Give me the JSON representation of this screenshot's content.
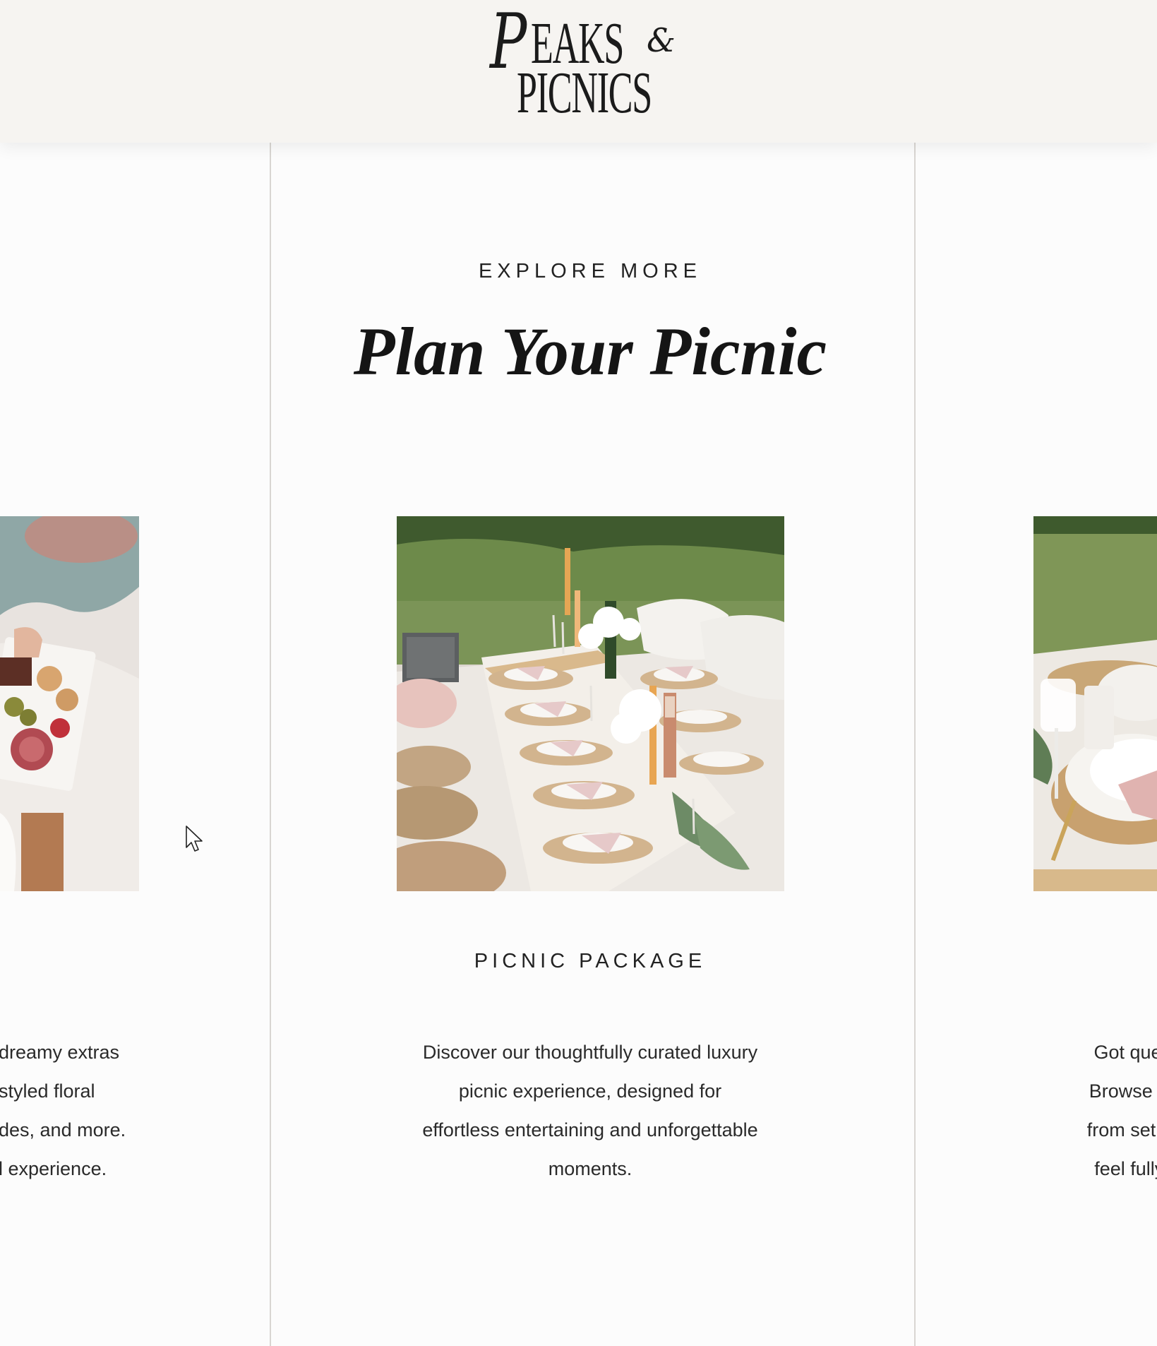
{
  "brand": {
    "logo_line1": "PEAKS",
    "logo_amp": "&",
    "logo_line2": "PICNICS"
  },
  "section": {
    "eyebrow": "EXPLORE MORE",
    "title": "Plan Your Picnic"
  },
  "cards": {
    "left": {
      "text": "dreamy extras\nstyled floral\ndes, and more.\nl experience."
    },
    "center": {
      "title": "PICNIC PACKAGE",
      "text": "Discover our thoughtfully curated luxury\npicnic experience, designed for\neffortless entertaining and unforgettable\nmoments."
    },
    "right": {
      "text": "Got questi\nBrowse our\nfrom setup t\nfeel fully p"
    }
  },
  "colors": {
    "header_bg": "#f6f4f1",
    "page_bg": "#fcfcfc",
    "divider": "#d9d6d2",
    "text": "#1d1d1d"
  }
}
